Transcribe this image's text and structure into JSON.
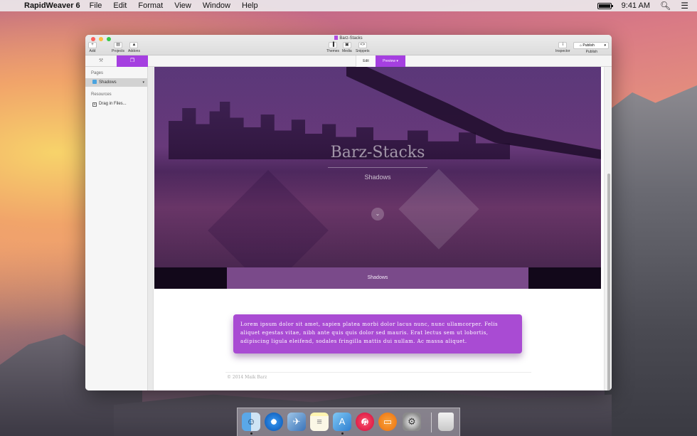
{
  "menubar": {
    "app_name": "RapidWeaver 6",
    "menus": [
      "File",
      "Edit",
      "Format",
      "View",
      "Window",
      "Help"
    ],
    "time": "9:41 AM"
  },
  "window": {
    "title": "Barz-Stacks",
    "toolbar": {
      "add": "Add",
      "projects": "Projects",
      "addons": "Addons",
      "themes": "Themes",
      "media": "Media",
      "snippets": "Snippets",
      "inspector": "Inspector",
      "publish_button": "Publish",
      "publish_label": "Publish"
    },
    "modes": {
      "edit": "Edit",
      "preview": "Preview"
    }
  },
  "sidebar": {
    "pages_header": "Pages",
    "pages": [
      {
        "label": "Shadows"
      }
    ],
    "resources_header": "Resources",
    "resources_item": "Drag in Files..."
  },
  "preview": {
    "hero_title": "Barz-Stacks",
    "hero_subtitle": "Shadows",
    "nav_item": "Shadows",
    "lorem": "Lorem ipsum dolor sit amet, sapien platea morbi dolor lacus nunc, nunc ullamcorper. Felis aliquet egestas vitae, nibh ante quis quis dolor sed mauris. Erat lectus sem ut lobortis, adipiscing ligula eleifend, sodales fringilla mattis dui nullam. Ac massa aliquet.",
    "footer": "© 2014 Maik Barz"
  },
  "colors": {
    "accent": "#a53fe0",
    "lorem_box": "#a94bd3",
    "nav_band": "#7a4a8a"
  }
}
